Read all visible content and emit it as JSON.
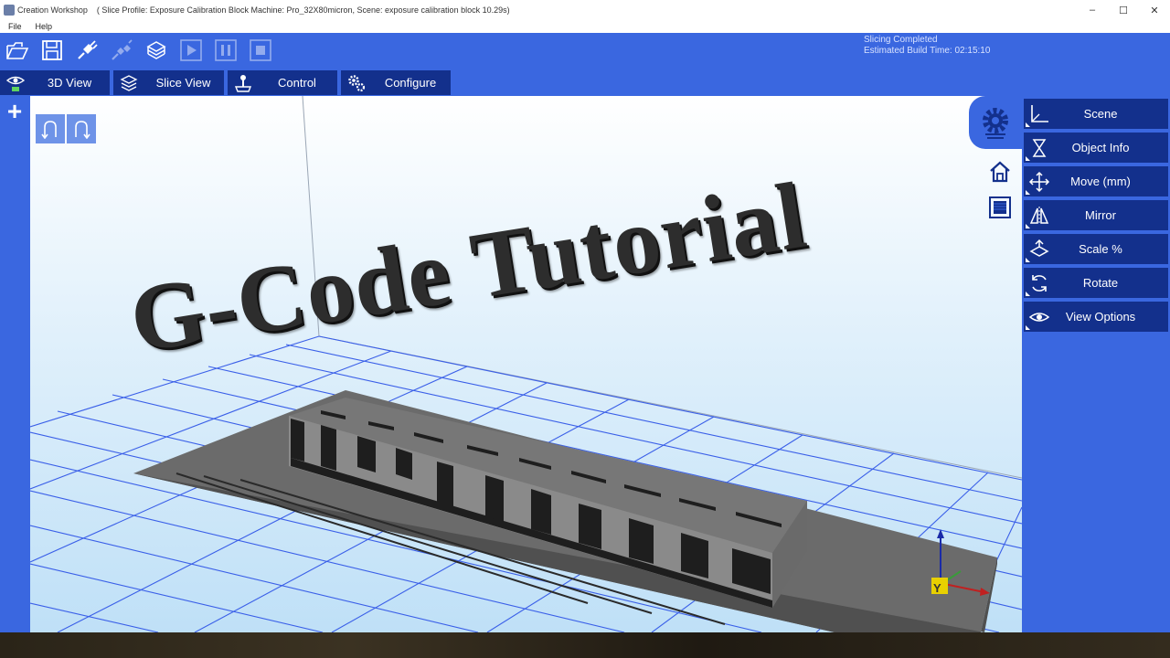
{
  "window": {
    "app_name": "Creation Workshop",
    "document_title": "( Slice Profile: Exposure Calibration Block Machine: Pro_32X80micron, Scene: exposure calibration block 10.29s)",
    "controls": [
      "–",
      "☐",
      "✕"
    ]
  },
  "menu": [
    "File",
    "Help"
  ],
  "toolbar": {
    "buttons": [
      {
        "name": "open-file",
        "icon": "folder-open-icon"
      },
      {
        "name": "save",
        "icon": "floppy-disk-icon"
      },
      {
        "name": "connect",
        "icon": "plug-connect-icon"
      },
      {
        "name": "disconnect",
        "icon": "plug-disconnect-icon"
      },
      {
        "name": "slice",
        "icon": "layers-icon"
      },
      {
        "name": "play",
        "icon": "play-icon"
      },
      {
        "name": "pause",
        "icon": "pause-icon"
      },
      {
        "name": "stop",
        "icon": "stop-icon"
      }
    ]
  },
  "status": {
    "line1": "Slicing Completed",
    "line2": "Estimated Build Time: 02:15:10"
  },
  "tabs": [
    {
      "label": "3D View",
      "icon": "eye-icon"
    },
    {
      "label": "Slice View",
      "icon": "layers-icon"
    },
    {
      "label": "Control",
      "icon": "joystick-icon"
    },
    {
      "label": "Configure",
      "icon": "gears-icon"
    }
  ],
  "viewport": {
    "overlay_text": "G-Code Tutorial",
    "axis_label": "Y"
  },
  "right_panel": {
    "buttons": [
      {
        "label": "Scene",
        "icon": "axes-icon"
      },
      {
        "label": "Object Info",
        "icon": "info-icon"
      },
      {
        "label": "Move (mm)",
        "icon": "move-arrows-icon"
      },
      {
        "label": "Mirror",
        "icon": "mirror-icon"
      },
      {
        "label": "Scale %",
        "icon": "scale-icon"
      },
      {
        "label": "Rotate",
        "icon": "rotate-icon"
      },
      {
        "label": "View Options",
        "icon": "eye-icon"
      }
    ]
  },
  "colors": {
    "app_blue": "#3a67e0",
    "button_navy": "#13308c",
    "grid_blue": "#3a5fe8",
    "model_gray": "#6e6e6e"
  }
}
